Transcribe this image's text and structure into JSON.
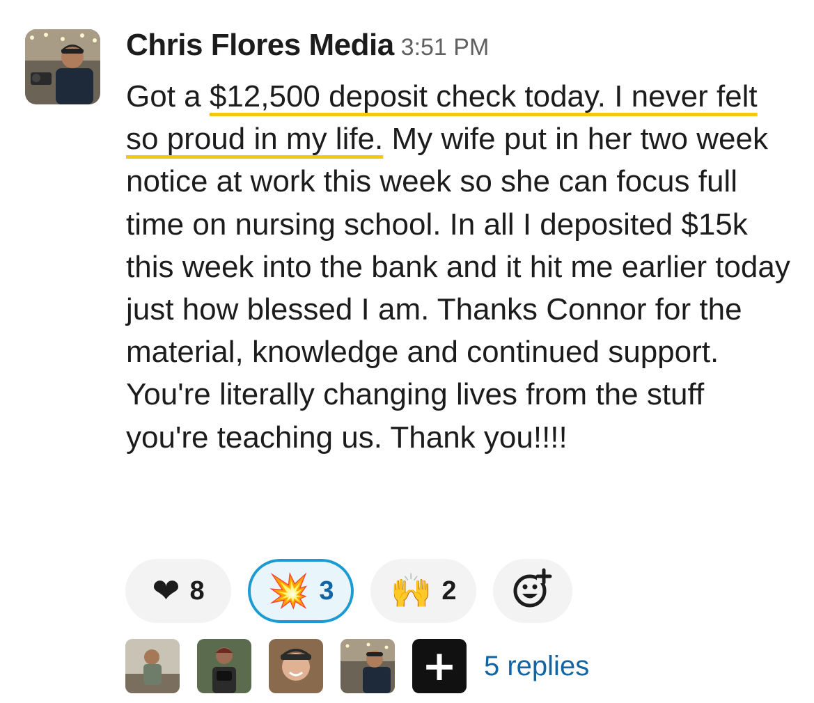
{
  "message": {
    "author": "Chris Flores Media",
    "timestamp": "3:51 PM",
    "text_before": "Got a ",
    "highlight": "$12,500 deposit check today. I never felt so proud in my life.",
    "text_after": " My wife put in her two week notice at work this week so she can focus full time on nursing school. In all I deposited $15k this week into the bank and it hit me earlier today just how blessed I am. Thanks Connor for the material, knowledge and continued support. You're literally changing lives from the stuff you're teaching us. Thank you!!!!"
  },
  "reactions": [
    {
      "icon": "heart-emoji",
      "glyph": "❤",
      "count": "8",
      "active": false
    },
    {
      "icon": "collision-emoji",
      "glyph": "💥",
      "count": "3",
      "active": true
    },
    {
      "icon": "raised-hands-emoji",
      "glyph": "🙌",
      "count": "2",
      "active": false
    }
  ],
  "add_reaction_icon": "add-reaction-icon",
  "thread": {
    "replies_label": "5 replies",
    "more_glyph": "+"
  },
  "colors": {
    "highlight_underline": "#f2c811",
    "link": "#1264a3",
    "active_reaction_border": "#1d9bd1"
  }
}
